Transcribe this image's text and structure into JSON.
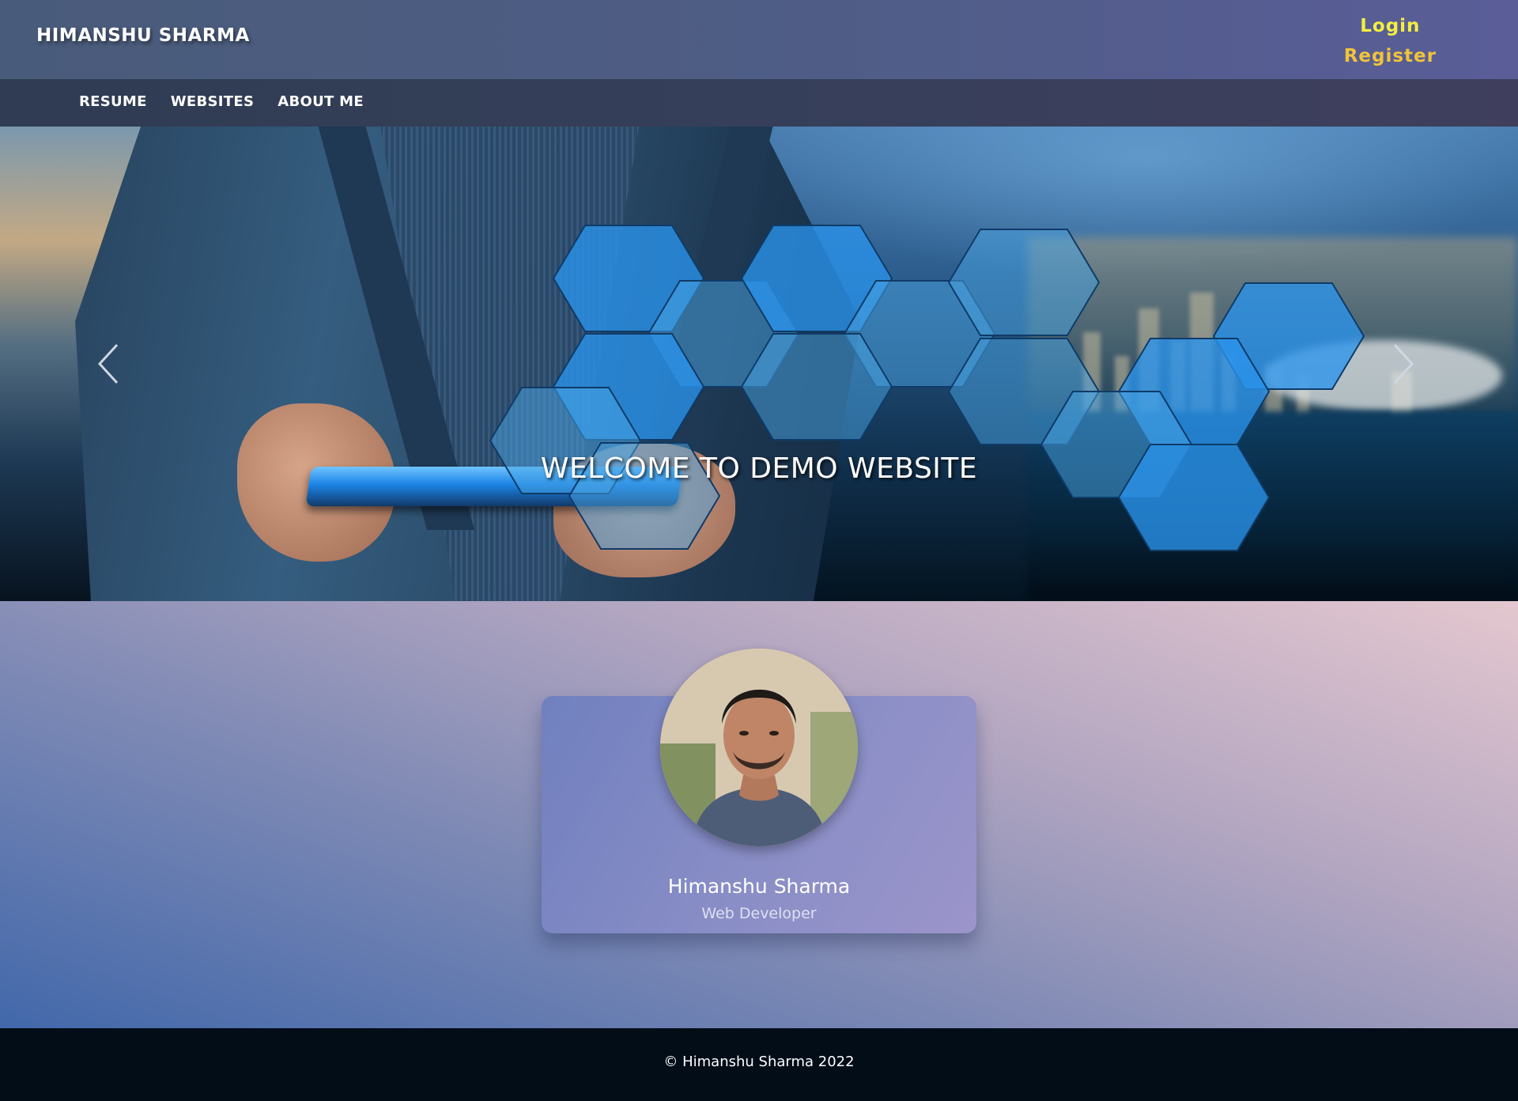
{
  "header": {
    "brand": "HIMANSHU SHARMA",
    "login": "Login",
    "register": "Register",
    "login_color": "#f3ee3f",
    "register_color": "#f0c43a"
  },
  "nav": {
    "items": [
      {
        "label": "RESUME"
      },
      {
        "label": "WEBSITES"
      },
      {
        "label": "ABOUT ME"
      }
    ]
  },
  "hero": {
    "caption": "WELCOME TO DEMO WEBSITE",
    "prev_icon": "chevron-left-icon",
    "next_icon": "chevron-right-icon"
  },
  "profile": {
    "name": "Himanshu Sharma",
    "role": "Web Developer"
  },
  "footer": {
    "text": "© Himanshu Sharma 2022"
  }
}
